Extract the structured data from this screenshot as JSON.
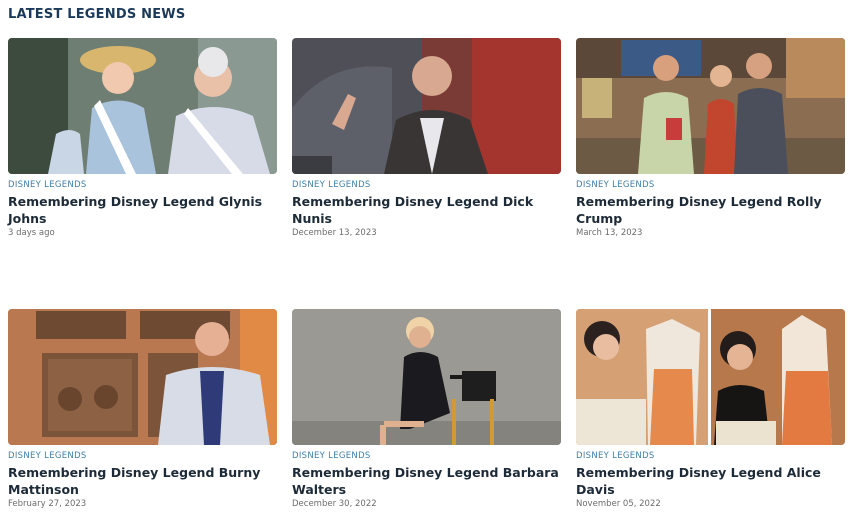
{
  "section": {
    "title": "LATEST LEGENDS NEWS"
  },
  "cards": [
    {
      "category": "DISNEY LEGENDS",
      "title": "Remembering Disney Legend Glynis Johns",
      "date": "3 days ago",
      "image_alt": "Glynis Johns in costume with suffragette sash"
    },
    {
      "category": "DISNEY LEGENDS",
      "title": "Remembering Disney Legend Dick Nunis",
      "date": "December 13, 2023",
      "image_alt": "Dick Nunis speaking on stage"
    },
    {
      "category": "DISNEY LEGENDS",
      "title": "Remembering Disney Legend Rolly Crump",
      "date": "March 13, 2023",
      "image_alt": "Rolly Crump with Walt Disney in a workshop"
    },
    {
      "category": "DISNEY LEGENDS",
      "title": "Remembering Disney Legend Burny Mattinson",
      "date": "February 27, 2023",
      "image_alt": "Burny Mattinson in front of handprint plaques"
    },
    {
      "category": "DISNEY LEGENDS",
      "title": "Remembering Disney Legend Barbara Walters",
      "date": "December 30, 2022",
      "image_alt": "Barbara Walters seated in a director's chair"
    },
    {
      "category": "DISNEY LEGENDS",
      "title": "Remembering Disney Legend Alice Davis",
      "date": "November 05, 2022",
      "image_alt": "Alice Davis with costume designs"
    }
  ],
  "colors": {
    "title": "#1b3a5a",
    "category": "#3f7fa8",
    "headline": "#1d2b38",
    "date": "#6c6c6c"
  }
}
